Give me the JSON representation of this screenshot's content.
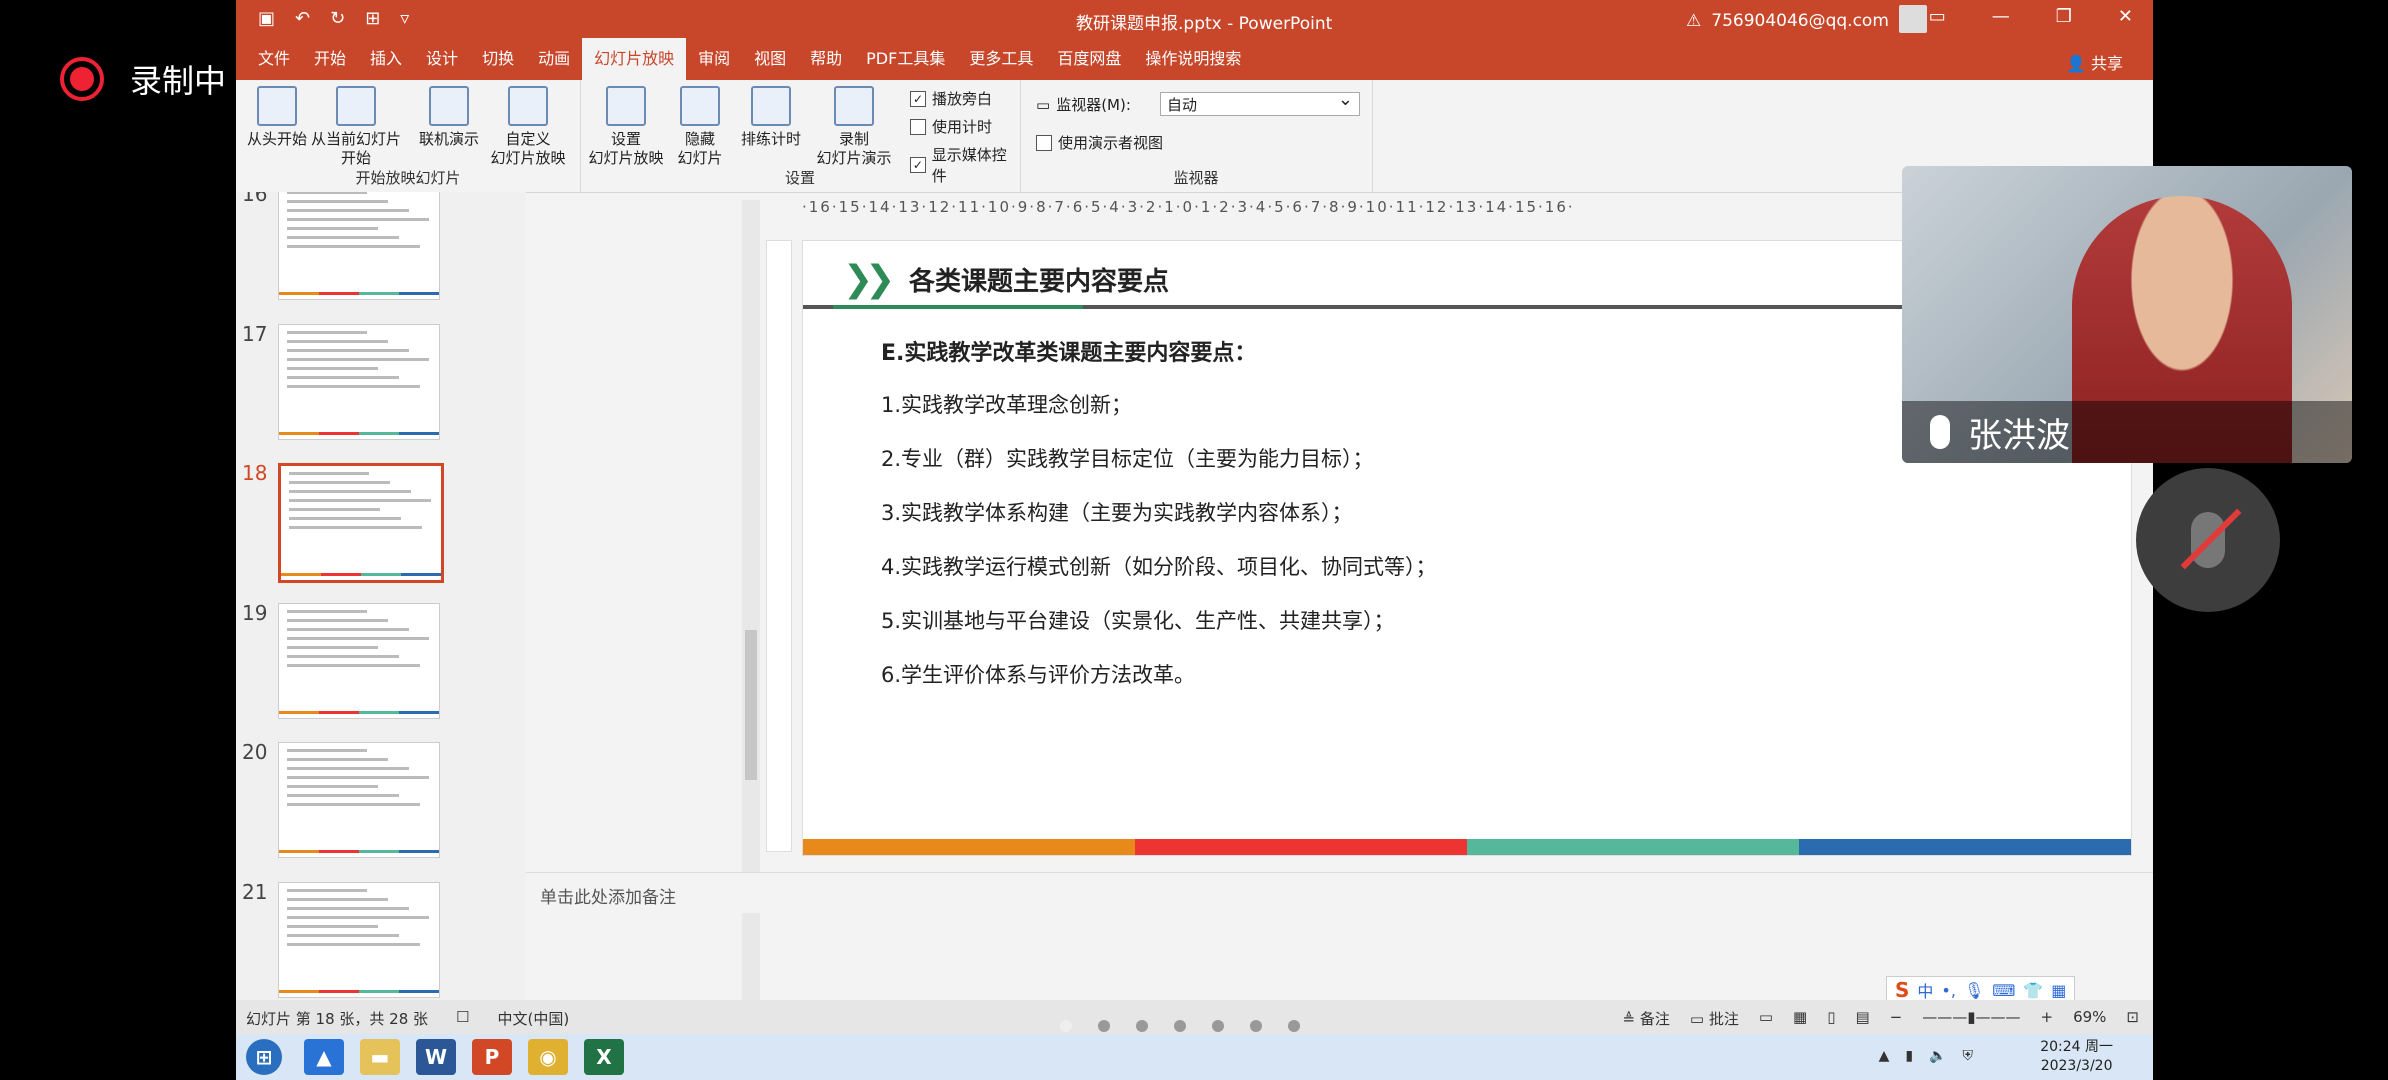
{
  "recording": {
    "label": "录制中"
  },
  "window": {
    "title": "教研课题申报.pptx  -  PowerPoint",
    "account": "756904046@qq.com",
    "tabs": [
      "文件",
      "开始",
      "插入",
      "设计",
      "切换",
      "动画",
      "幻灯片放映",
      "审阅",
      "视图",
      "帮助",
      "PDF工具集",
      "更多工具",
      "百度网盘",
      "操作说明搜索"
    ],
    "active_tab": "幻灯片放映",
    "share": "共享"
  },
  "ribbon": {
    "group1": {
      "label": "开始放映幻灯片",
      "buttons": [
        "从头开始",
        "从当前幻灯片\n开始",
        "联机演示",
        "自定义\n幻灯片放映"
      ]
    },
    "group2": {
      "label": "设置",
      "buttons": [
        "设置\n幻灯片放映",
        "隐藏\n幻灯片",
        "排练计时",
        "录制\n幻灯片演示"
      ],
      "checks": [
        {
          "label": "播放旁白",
          "checked": true
        },
        {
          "label": "使用计时",
          "checked": false
        },
        {
          "label": "显示媒体控件",
          "checked": true
        }
      ]
    },
    "group3": {
      "label": "监视器",
      "monitor_label": "监视器(M):",
      "monitor_value": "自动",
      "presenter_view": "使用演示者视图"
    }
  },
  "thumbnails": [
    {
      "num": "16",
      "selected": false
    },
    {
      "num": "17",
      "selected": false
    },
    {
      "num": "18",
      "selected": true
    },
    {
      "num": "19",
      "selected": false
    },
    {
      "num": "20",
      "selected": false
    },
    {
      "num": "21",
      "selected": false
    }
  ],
  "ruler": "·16·15·14·13·12·11·10·9·8·7·6·5·4·3·2·1·0·1·2·3·4·5·6·7·8·9·10·11·12·13·14·15·16·",
  "slide": {
    "title": "各类课题主要内容要点",
    "subhead": "E.实践教学改革类课题主要内容要点：",
    "items": [
      "1.实践教学改革理念创新；",
      "2.专业（群）实践教学目标定位（主要为能力目标）；",
      "3.实践教学体系构建（主要为实践教学内容体系）；",
      "4.实践教学运行模式创新（如分阶段、项目化、协同式等）；",
      "5.实训基地与平台建设（实景化、生产性、共建共享）；",
      "6.学生评价体系与评价方法改革。"
    ]
  },
  "notes": "单击此处添加备注",
  "status": {
    "slide_info": "幻灯片 第 18 张，共 28 张",
    "lang": "中文(中国)",
    "notes_btn": "备注",
    "comments_btn": "批注",
    "zoom": "69%"
  },
  "taskbar": {
    "time": "20:24 周一",
    "date": "2023/3/20"
  },
  "video": {
    "name": "张洪波"
  }
}
